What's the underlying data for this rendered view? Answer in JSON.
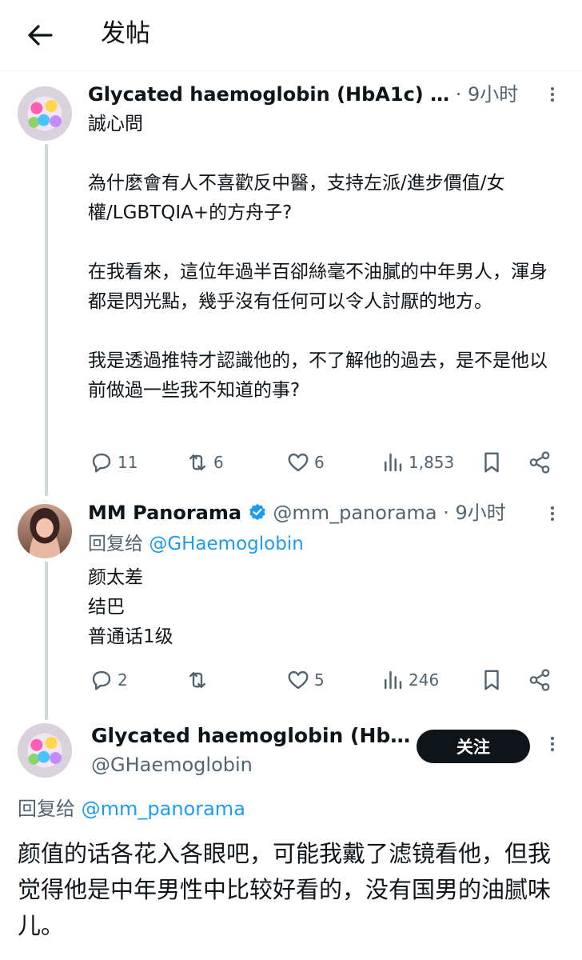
{
  "header": {
    "title": "发帖"
  },
  "tweets": [
    {
      "name": "Glycated haemoglobin (HbA1c) …",
      "meta": " · 9小时",
      "text": "誠心問\n\n為什麼會有人不喜歡反中醫，支持左派/進步價值/女權/LGBTQIA+的方舟子?\n\n在我看來，這位年過半百卻絲毫不油膩的中年男人，渾身都是閃光點，幾乎沒有任何可以令人討厭的地方。\n\n我是透過推特才認識他的，不了解他的過去，是不是他以前做過一些我不知道的事?",
      "replies": "11",
      "retweets": "6",
      "likes": "6",
      "views": "1,853"
    },
    {
      "name": "MM Panorama",
      "handle": "@mm_panorama",
      "meta": " · 9小时",
      "reply_prefix": "回复给 ",
      "reply_to": "@GHaemoglobin",
      "text": "颜太差\n结巴\n普通话1级",
      "replies": "2",
      "retweets": "",
      "likes": "5",
      "views": "246"
    }
  ],
  "focus": {
    "name": "Glycated haemoglobin (Hb…",
    "handle": "@GHaemoglobin",
    "follow_label": "关注",
    "reply_prefix": "回复给 ",
    "reply_to": "@mm_panorama",
    "text": "颜值的话各花入各眼吧，可能我戴了滤镜看他，但我觉得他是中年男性中比较好看的，没有国男的油腻味儿。"
  },
  "icons": [
    "back-arrow-icon",
    "more-icon",
    "verified-badge-icon",
    "reply-icon",
    "retweet-icon",
    "like-icon",
    "views-icon",
    "bookmark-icon",
    "share-icon"
  ],
  "colors": {
    "accent": "#1d9bf0",
    "text": "#0f1419",
    "muted": "#536471",
    "thread": "#cfd9de"
  }
}
